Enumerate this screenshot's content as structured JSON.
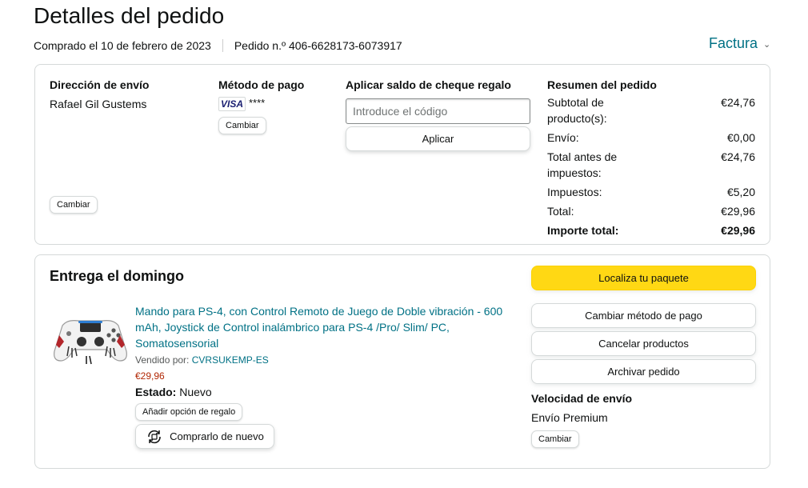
{
  "header": {
    "title": "Detalles del pedido",
    "purchase_date": "Comprado el 10 de febrero de 2023",
    "order_number": "Pedido n.º 406-6628173-6073917",
    "invoice_label": "Factura"
  },
  "shipping": {
    "heading": "Dirección de envío",
    "name": "Rafael Gil Gustems",
    "change_label": "Cambiar"
  },
  "payment": {
    "heading": "Método de pago",
    "card_brand": "VISA",
    "card_mask": "****",
    "change_label": "Cambiar"
  },
  "gift": {
    "heading": "Aplicar saldo de cheque regalo",
    "placeholder": "Introduce el código",
    "apply_label": "Aplicar"
  },
  "summary": {
    "heading": "Resumen del pedido",
    "rows": [
      {
        "label": "Subtotal de producto(s):",
        "value": "€24,76"
      },
      {
        "label": "Envío:",
        "value": "€0,00"
      },
      {
        "label": "Total antes de impuestos:",
        "value": "€24,76"
      },
      {
        "label": "Impuestos:",
        "value": "€5,20"
      },
      {
        "label": "Total:",
        "value": "€29,96"
      },
      {
        "label": "Importe total:",
        "value": "€29,96"
      }
    ]
  },
  "delivery": {
    "title": "Entrega el domingo",
    "product": {
      "name": "Mando para PS-4, con Control Remoto de Juego de Doble vibración - 600 mAh, Joystick de Control inalámbrico para PS-4 /Pro/ Slim/ PC, Somatosensorial",
      "sold_by_label": "Vendido por:",
      "seller": "CVRSUKEMP-ES",
      "price": "€29,96",
      "state_label": "Estado:",
      "state_value": "Nuevo",
      "gift_option_label": "Añadir opción de regalo",
      "buy_again_label": "Comprarlo de nuevo"
    },
    "actions": {
      "track": "Localiza tu paquete",
      "change_payment": "Cambiar método de pago",
      "cancel": "Cancelar productos",
      "archive": "Archivar pedido"
    },
    "speed": {
      "heading": "Velocidad de envío",
      "value": "Envío Premium",
      "change_label": "Cambiar"
    }
  },
  "colors": {
    "link": "#007185",
    "price": "#b12704",
    "primary_button": "#ffd814",
    "border": "#d5d9d9"
  }
}
